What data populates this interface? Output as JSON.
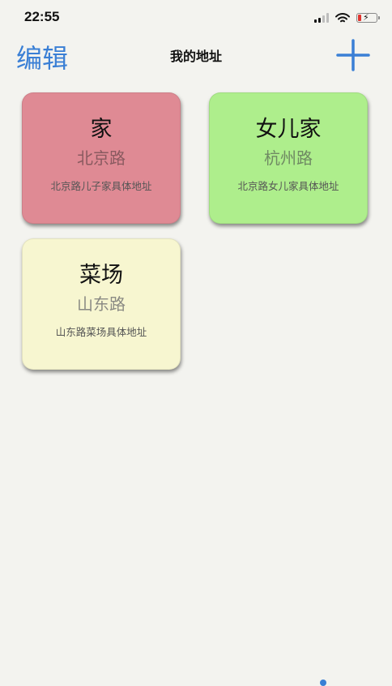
{
  "status_bar": {
    "time": "22:55",
    "icons": [
      "signal-icon",
      "wifi-icon",
      "battery-charging-icon"
    ]
  },
  "nav": {
    "edit_label": "编辑",
    "title": "我的地址",
    "add_icon": "plus-icon"
  },
  "addresses": [
    {
      "name": "家",
      "street": "北京路",
      "detail": "北京路儿子家具体地址",
      "color": "#df8a94"
    },
    {
      "name": "女儿家",
      "street": "杭州路",
      "detail": "北京路女儿家具体地址",
      "color": "#aeee8c"
    },
    {
      "name": "菜场",
      "street": "山东路",
      "detail": "山东路菜场具体地址",
      "color": "#f7f6d0"
    }
  ],
  "colors": {
    "accent": "#3a7fd5",
    "background": "#f3f3ef"
  }
}
